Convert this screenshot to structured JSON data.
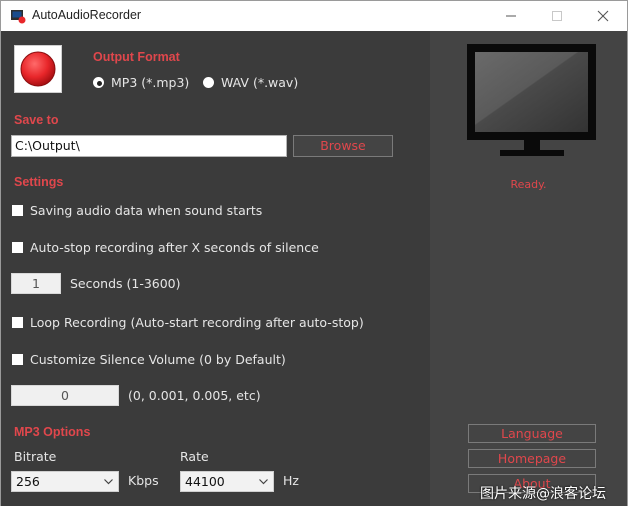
{
  "window": {
    "title": "AutoAudioRecorder"
  },
  "output_format": {
    "title": "Output Format",
    "options": [
      {
        "label": "MP3 (*.mp3)",
        "selected": true
      },
      {
        "label": "WAV (*.wav)",
        "selected": false
      }
    ]
  },
  "save_to": {
    "title": "Save to",
    "path_value": "C:\\Output\\",
    "browse_label": "Browse"
  },
  "settings": {
    "title": "Settings",
    "saving_on_sound": {
      "label": "Saving audio data when sound starts",
      "checked": false
    },
    "auto_stop": {
      "label": "Auto-stop recording after X seconds of silence",
      "checked": false
    },
    "seconds_value": "1",
    "seconds_label": "Seconds (1-3600)",
    "loop_recording": {
      "label": "Loop Recording (Auto-start recording after auto-stop)",
      "checked": false
    },
    "custom_silence": {
      "label": "Customize Silence Volume (0 by Default)",
      "checked": false
    },
    "silence_value": "0",
    "silence_hint": "(0, 0.001, 0.005, etc)"
  },
  "mp3_options": {
    "title": "MP3 Options",
    "bitrate_label": "Bitrate",
    "bitrate_value": "256",
    "bitrate_unit": "Kbps",
    "rate_label": "Rate",
    "rate_value": "44100",
    "rate_unit": "Hz"
  },
  "side_panel": {
    "status": "Ready.",
    "language_label": "Language",
    "homepage_label": "Homepage",
    "about_label": "About"
  },
  "watermark": "图片来源@浪客论坛",
  "colors": {
    "accent": "#e0474c",
    "record_red": "#e8262a",
    "panel_bg": "#3b3b3b",
    "side_bg": "#444444"
  },
  "icons": {
    "record": "record-icon",
    "monitor": "monitor-icon",
    "minimize": "minimize-icon",
    "maximize": "maximize-icon",
    "close": "close-icon",
    "dropdown": "chevron-down-icon"
  }
}
